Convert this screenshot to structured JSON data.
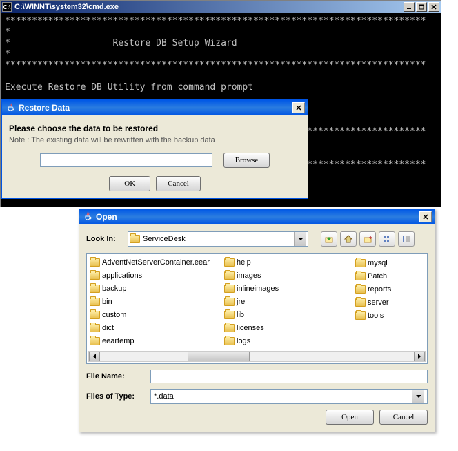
{
  "cmd": {
    "title": "C:\\WINNT\\system32\\cmd.exe",
    "lines": "******************************************************************************\n*\n*                   Restore DB Setup Wizard\n*\n******************************************************************************\n\nExecute Restore DB Utility from command prompt\n\n        For Windows users :\n                bin>restoreData -c [backup file]\n******************************************************************************\n*\n*\n******************************************************************************\n\n\n\n"
  },
  "restore": {
    "title": "Restore Data",
    "heading": "Please choose the data to be restored",
    "note": "Note : The existing data will be rewritten with the backup data",
    "path_value": "",
    "browse": "Browse",
    "ok": "OK",
    "cancel": "Cancel"
  },
  "open": {
    "title": "Open",
    "lookin_label": "Look In:",
    "lookin_value": "ServiceDesk",
    "filename_label": "File Name:",
    "filename_value": "",
    "filetype_label": "Files of Type:",
    "filetype_value": "*.data",
    "open_btn": "Open",
    "cancel_btn": "Cancel",
    "col1": [
      "AdventNetServerContainer.eear",
      "applications",
      "backup",
      "bin",
      "custom",
      "dict",
      "eeartemp"
    ],
    "col2": [
      "help",
      "images",
      "inlineimages",
      "jre",
      "lib",
      "licenses",
      "logs"
    ],
    "col3": [
      "mysql",
      "Patch",
      "reports",
      "server",
      "tools"
    ]
  }
}
